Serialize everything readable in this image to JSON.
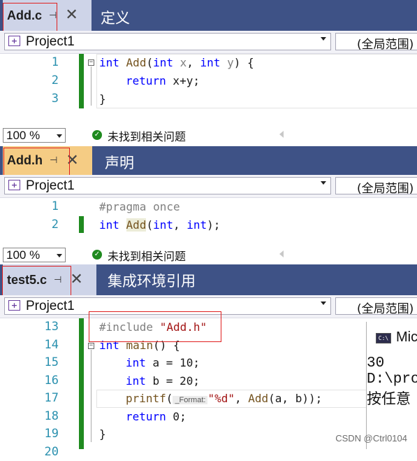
{
  "panels": [
    {
      "file_tab": "Add.c",
      "section_label": "定义",
      "project": "Project1",
      "scope": "(全局范围)",
      "lines": [
        {
          "num": "1"
        },
        {
          "num": "2"
        },
        {
          "num": "3"
        }
      ],
      "zoom": "100 %",
      "status": "未找到相关问题"
    },
    {
      "file_tab": "Add.h",
      "section_label": "声明",
      "project": "Project1",
      "scope": "(全局范围)",
      "lines": [
        {
          "num": "1"
        },
        {
          "num": "2"
        }
      ],
      "zoom": "100 %",
      "status": "未找到相关问题"
    },
    {
      "file_tab": "test5.c",
      "section_label": "集成环境引用",
      "project": "Project1",
      "scope": "(全局范围)",
      "lines": [
        {
          "num": "13"
        },
        {
          "num": "14"
        },
        {
          "num": "15"
        },
        {
          "num": "16"
        },
        {
          "num": "17"
        },
        {
          "num": "18"
        },
        {
          "num": "19"
        },
        {
          "num": "20"
        }
      ]
    }
  ],
  "code": {
    "add_c": {
      "l1": {
        "kw1": "int",
        "fn": "Add",
        "open": "(",
        "kw2": "int",
        "p1": " x",
        "comma": ", ",
        "kw3": "int",
        "p2": " y",
        "close": ") {"
      },
      "l2": {
        "kw": "return",
        "rest": " x+y;"
      },
      "l3": {
        "rest": "}"
      }
    },
    "add_h": {
      "l1": {
        "pre": "#pragma once"
      },
      "l2": {
        "kw1": "int",
        "fn": "Add",
        "open": "(",
        "kw2": "int",
        "comma": ", ",
        "kw3": "int",
        "close": ");"
      }
    },
    "test5": {
      "l13": {
        "pre": "#include ",
        "str": "\"Add.h\""
      },
      "l14": {
        "kw": "int",
        "fn": "main",
        "rest": "() {"
      },
      "l15": {
        "kw": "int",
        "rest": " a = 10;"
      },
      "l16": {
        "kw": "int",
        "rest": " b = 20;"
      },
      "l17": {
        "fn": "printf",
        "open": "(",
        "hint": "_Format:",
        "str": "\"%d\"",
        "mid": ", ",
        "fn2": "Add",
        "args": "(a, b));"
      },
      "l18": {
        "kw": "return",
        "rest": " 0;"
      },
      "l19": {
        "rest": "}"
      }
    }
  },
  "console": {
    "title": "Mic",
    "icon": "C:\\",
    "lines": [
      "30",
      "D:\\pro",
      "按任意"
    ]
  },
  "watermark": "CSDN @Ctrl0104",
  "colors": {
    "tabstrip": "#3e5286",
    "active_tab": "#f5cc84",
    "inactive_tab": "#ced4e8",
    "keyword": "#0000ff",
    "function": "#74531f",
    "string": "#a31515",
    "line_number": "#2b91af",
    "change_bar": "#1f8a1f"
  }
}
